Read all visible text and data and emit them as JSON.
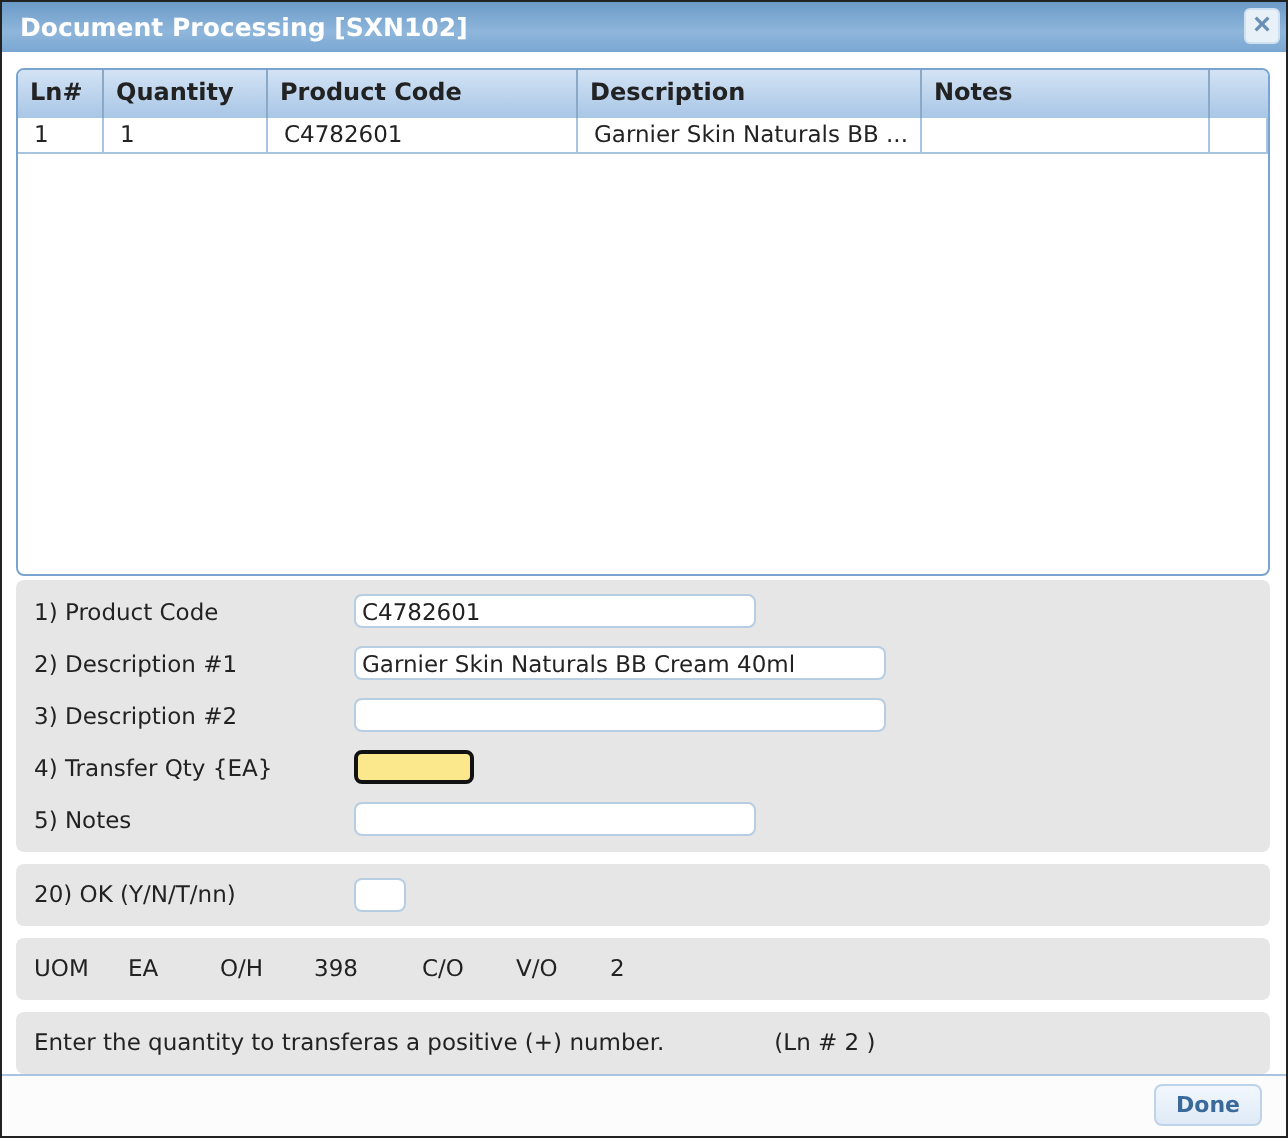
{
  "window": {
    "title": "Document Processing [SXN102]",
    "close": "×"
  },
  "table": {
    "columns": [
      "Ln#",
      "Quantity",
      "Product Code",
      "Description",
      "Notes"
    ],
    "rows": [
      [
        "1",
        "1",
        "C4782601",
        "Garnier Skin Naturals BB ..."
      ]
    ]
  },
  "form": [
    {
      "label": "1) Product Code",
      "value": "C4782601",
      "focused": false
    },
    {
      "label": "2) Description #1",
      "value": "Garnier Skin Naturals BB Cream 40ml",
      "focused": false
    },
    {
      "label": "3) Description #2",
      "focused": false
    },
    {
      "label": "4) Transfer Qty {EA}",
      "focused": true
    },
    {
      "label": "5) Notes",
      "focused": false
    }
  ],
  "ok": {
    "label": "20) OK (Y/N/T/nn)"
  },
  "info": [
    "UOM",
    "EA",
    "O/H",
    "398",
    "C/O",
    "V/O",
    "2"
  ],
  "message": {
    "text": "Enter the quantity to transferas a positive (+) number.",
    "line": "(Ln # 2 )"
  },
  "buttons": [
    "Done"
  ]
}
